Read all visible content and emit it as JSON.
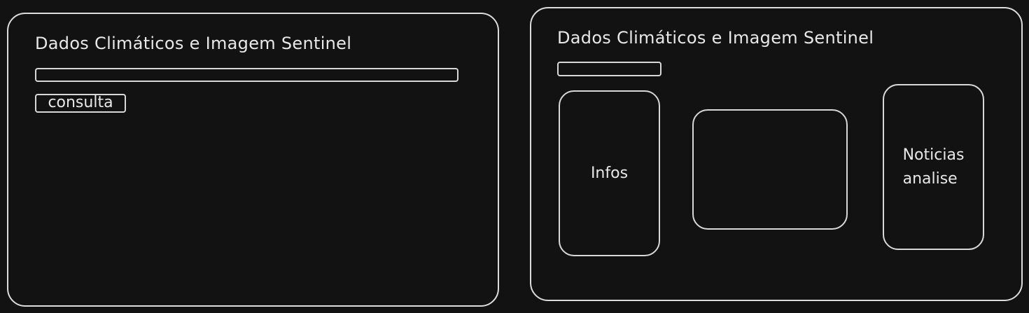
{
  "left_screen": {
    "title": "Dados Climáticos e Imagem Sentinel",
    "search_input_value": "",
    "button_label": "consulta"
  },
  "right_screen": {
    "title": "Dados Climáticos e Imagem Sentinel",
    "search_input_value": "",
    "cards": {
      "infos": "Infos",
      "center": "",
      "noticias_line1": "Noticias",
      "noticias_line2": "analise"
    }
  },
  "colors": {
    "background": "#121212",
    "stroke": "#dcdcdc",
    "text": "#e8e8e8"
  }
}
